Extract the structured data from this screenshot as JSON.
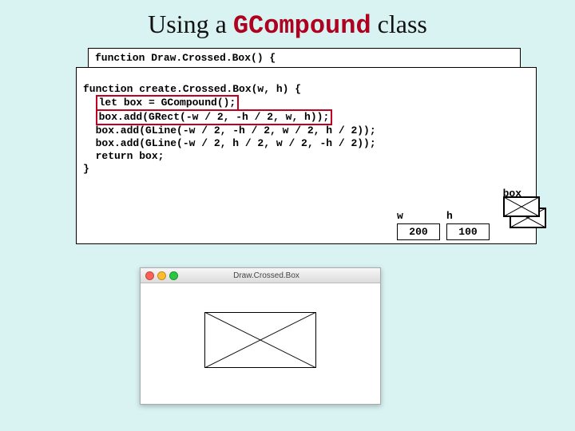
{
  "title_prefix": "Using a ",
  "title_mono": "GCompound",
  "title_suffix": " class",
  "back_line1": "function Draw.Crossed.Box() {",
  "code_lines": [
    "function create.Crossed.Box(w, h) {",
    "  let box = GCompound();",
    "  box.add(GRect(-w / 2, -h / 2, w, h));",
    "  box.add(GLine(-w / 2, -h / 2, w / 2, h / 2));",
    "  box.add(GLine(-w / 2, h / 2, w / 2, -h / 2));",
    "  return box;",
    "}"
  ],
  "highlight_indices": [
    1,
    2
  ],
  "vars": {
    "box_label": "box",
    "w_label": "w",
    "w_value": "200",
    "h_label": "h",
    "h_value": "100"
  },
  "window_title": "Draw.Crossed.Box"
}
